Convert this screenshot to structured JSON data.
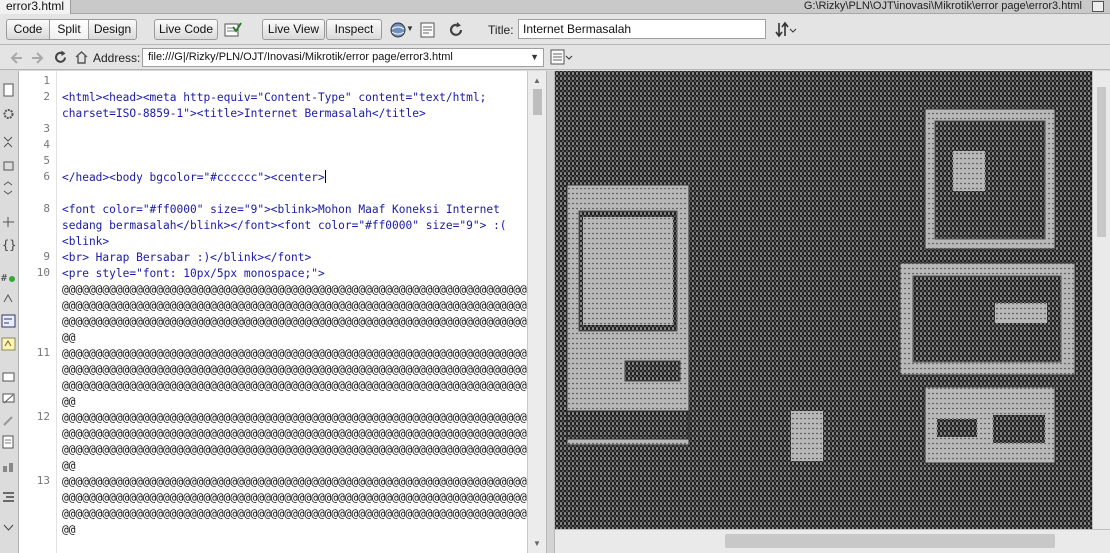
{
  "tab": {
    "filename": "error3.html"
  },
  "window": {
    "path": "G:\\Rizky\\PLN\\OJT\\inovasi\\Mikrotik\\error page\\error3.html"
  },
  "toolbar": {
    "code_label": "Code",
    "split_label": "Split",
    "design_label": "Design",
    "live_code_label": "Live Code",
    "live_view_label": "Live View",
    "inspect_label": "Inspect",
    "title_label": "Title:",
    "title_value": "Internet Bermasalah"
  },
  "address": {
    "label": "Address:",
    "value": "file:///G|/Rizky/PLN/OJT/Inovasi/Mikrotik/error page/error3.html"
  },
  "code": {
    "line_numbers": [
      "1",
      "2",
      "3",
      "4",
      "5",
      "6",
      "8",
      "9",
      "10",
      "11",
      "12",
      "13"
    ],
    "lines": {
      "l2a": "<html><head><meta http-equiv=\"Content-Type\" content=\"text/html;",
      "l2b": "charset=ISO-8859-1\"><title>Internet Bermasalah</title>",
      "l6": "</head><body bgcolor=\"#cccccc\"><center>",
      "l8a": "<font color=\"#ff0000\" size=\"9\"><blink>Mohon Maaf Koneksi Internet",
      "l8b": "sedang bermasalah</blink></font><font color=\"#ff0000\" size=\"9\"> :(",
      "l8c": "<blink>",
      "l9": "<br> Harap Bersabar :)</blink></font>",
      "l10": "<pre style=\"font: 10px/5px monospace;\">",
      "at_row": "@@@@@@@@@@@@@@@@@@@@@@@@@@@@@@@@@@@@@@@@@@@@@@@@@@@@@@@@@@@@@@@@@@@@@",
      "at_tail": "@@"
    }
  },
  "colors": {
    "code_tag": "#1a1aa6",
    "live_bg": "#cccccc",
    "ascii_char": "#2b2b2b"
  },
  "icons": [
    "document-icon",
    "gear-icon",
    "refresh-icon",
    "globe-icon",
    "back-icon",
    "forward-icon",
    "home-icon",
    "options-icon",
    "validate-icon"
  ]
}
